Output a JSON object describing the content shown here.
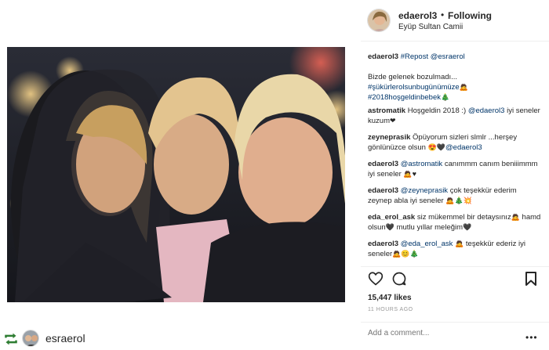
{
  "header": {
    "username": "edaerol3",
    "separator": "•",
    "follow_status": "Following",
    "location": "Eyüp Sultan Camii"
  },
  "comments": [
    {
      "user": "edaerol3",
      "parts": [
        {
          "t": "tag",
          "v": "#Repost"
        },
        {
          "t": "tag",
          "v": " @esraerol"
        },
        {
          "t": "br"
        },
        {
          "t": "br"
        },
        {
          "t": "text",
          "v": "Bizde gelenek bozulmadı..."
        },
        {
          "t": "br"
        },
        {
          "t": "tag",
          "v": "#şükürlerolsunbugünümüze"
        },
        {
          "t": "emoji",
          "v": "🙇"
        },
        {
          "t": "br"
        },
        {
          "t": "tag",
          "v": "#2018hoşgeldinbebek"
        },
        {
          "t": "emoji",
          "v": "🎄"
        }
      ]
    },
    {
      "user": "astromatik",
      "parts": [
        {
          "t": "text",
          "v": " Hoşgeldin 2018 :) "
        },
        {
          "t": "tag",
          "v": "@edaerol3"
        },
        {
          "t": "text",
          "v": " iyi seneler kuzum"
        },
        {
          "t": "emoji",
          "v": "❤"
        }
      ]
    },
    {
      "user": "zeyneprasik",
      "parts": [
        {
          "t": "text",
          "v": " Öpüyorum sizleri slmlr ...herşey gönlünüzce olsun "
        },
        {
          "t": "emoji",
          "v": "😍"
        },
        {
          "t": "emoji",
          "v": "🖤"
        },
        {
          "t": "tag",
          "v": "@edaerol3"
        }
      ]
    },
    {
      "user": "edaerol3",
      "parts": [
        {
          "t": "text",
          "v": " "
        },
        {
          "t": "tag",
          "v": "@astromatik"
        },
        {
          "t": "text",
          "v": " canımmm canım beniiimmm iyi seneler "
        },
        {
          "t": "emoji",
          "v": "🙇"
        },
        {
          "t": "emoji",
          "v": "♥"
        }
      ]
    },
    {
      "user": "edaerol3",
      "parts": [
        {
          "t": "text",
          "v": " "
        },
        {
          "t": "tag",
          "v": "@zeyneprasik"
        },
        {
          "t": "text",
          "v": " çok teşekkür ederim zeynep abla iyi seneler "
        },
        {
          "t": "emoji",
          "v": "🙇"
        },
        {
          "t": "emoji",
          "v": "🎄"
        },
        {
          "t": "emoji",
          "v": "💥"
        }
      ]
    },
    {
      "user": "eda_erol_ask",
      "parts": [
        {
          "t": "text",
          "v": " siz mükemmel bir detaysınız"
        },
        {
          "t": "emoji",
          "v": "🙇"
        },
        {
          "t": "text",
          "v": " hamd olsun"
        },
        {
          "t": "emoji",
          "v": "🖤"
        },
        {
          "t": "text",
          "v": " mutlu yıllar meleğim"
        },
        {
          "t": "emoji",
          "v": "🖤"
        }
      ]
    },
    {
      "user": "edaerol3",
      "parts": [
        {
          "t": "text",
          "v": " "
        },
        {
          "t": "tag",
          "v": "@eda_erol_ask"
        },
        {
          "t": "text",
          "v": " "
        },
        {
          "t": "emoji",
          "v": "🙇"
        },
        {
          "t": "text",
          "v": " teşekkür ederiz iyi seneler"
        },
        {
          "t": "emoji",
          "v": "🙇"
        },
        {
          "t": "emoji",
          "v": "😊"
        },
        {
          "t": "emoji",
          "v": "🎄"
        }
      ]
    }
  ],
  "engagement": {
    "likes": "15,447 likes",
    "time_ago": "11 HOURS AGO"
  },
  "add_comment": {
    "placeholder": "Add a comment..."
  },
  "more_icon": "•••",
  "repost": {
    "username": "esraerol"
  },
  "icons": {
    "heart": "heart-icon",
    "comment": "comment-icon",
    "bookmark": "bookmark-icon",
    "repost": "repost-icon",
    "more": "more-options-icon"
  },
  "colors": {
    "text": "#262626",
    "link": "#003569",
    "muted": "#999999",
    "divider": "#efefef",
    "repost_green": "#2e7d32"
  }
}
